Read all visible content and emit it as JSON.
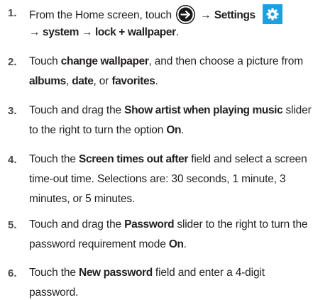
{
  "steps": [
    {
      "number": "1.",
      "lines": [
        [
          "From the Home screen, touch ",
          "[arrow-icon]",
          " → ",
          "**Settings**",
          " ",
          "[gear-icon]"
        ],
        [
          "**→ system → lock + wallpaper**",
          "."
        ]
      ]
    },
    {
      "number": "2.",
      "lines": [
        [
          "Touch ",
          "**change wallpaper**",
          ", and then choose a picture from"
        ],
        [
          "**albums**",
          ", ",
          "**date**",
          ", or ",
          "**favorites**",
          "."
        ]
      ]
    },
    {
      "number": "3.",
      "lines": [
        [
          "Touch and drag the ",
          "**Show artist when playing music**",
          " slider"
        ],
        [
          "to the right to turn the option ",
          "**On**",
          "."
        ]
      ]
    },
    {
      "number": "4.",
      "lines": [
        [
          "Touch the ",
          "**Screen times out after**",
          " field and select a screen"
        ],
        [
          "time-out time. Selections are: 30 seconds, 1 minute, 3"
        ],
        [
          "minutes, or 5 minutes."
        ]
      ]
    },
    {
      "number": "5.",
      "lines": [
        [
          "Touch and drag the ",
          "**Password**",
          " slider to the right to turn the"
        ],
        [
          "password requirement mode ",
          "**On**",
          "."
        ]
      ]
    },
    {
      "number": "6.",
      "lines": [
        [
          "Touch the ",
          "**New password**",
          " field and enter a 4-digit"
        ],
        [
          "password."
        ]
      ]
    }
  ]
}
